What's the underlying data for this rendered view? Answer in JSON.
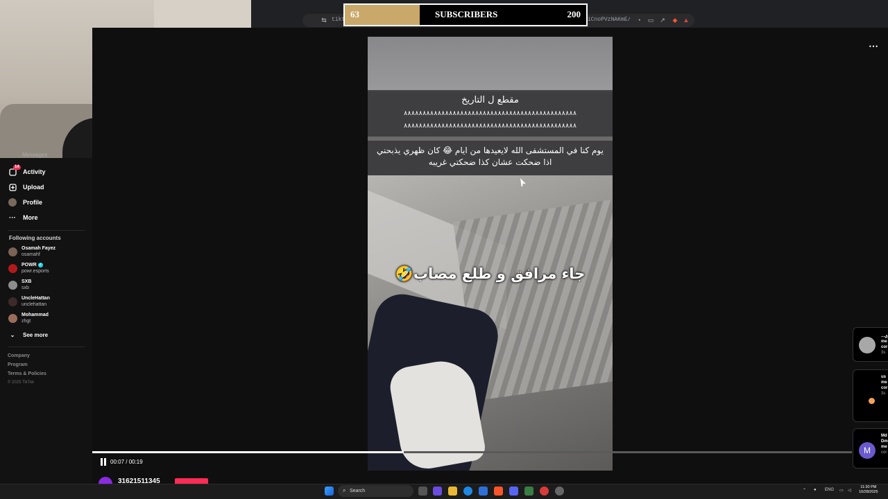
{
  "browser": {
    "url": "tiktok.com/@.../video/... MfDjnyZmkv8IzH-Kd7Y83j5-U8RbfWbvEZ8iAii1qfUiCnoPVzNAKmE/video/7549859768807066898",
    "url_prefix": "tiktok"
  },
  "subscribers": {
    "start": "63",
    "label": "SUBSCRIBERS",
    "goal": "200",
    "progress_fraction": 0.31
  },
  "sidebar": {
    "cut_item": "Messages",
    "items": [
      {
        "label": "Activity",
        "icon": "activity-icon",
        "badge": "14"
      },
      {
        "label": "Upload",
        "icon": "upload-icon"
      },
      {
        "label": "Profile",
        "icon": "profile-avatar"
      },
      {
        "label": "More",
        "icon": "more-dots-icon"
      }
    ],
    "following_title": "Following accounts",
    "accounts": [
      {
        "name": "Osamah Fayez",
        "handle": "osamahf"
      },
      {
        "name": "POWR",
        "handle": "powr.esports",
        "verified": true
      },
      {
        "name": "SXB",
        "handle": "sxb"
      },
      {
        "name": "UncleHattan",
        "handle": "unclehattan"
      },
      {
        "name": "Mohammad",
        "handle": "zhgt"
      }
    ],
    "see_more": "See more",
    "footer": [
      "Company",
      "Program",
      "Terms & Policies"
    ],
    "copyright": "© 2025 TikTok"
  },
  "video": {
    "caption_title": "مقطع ل التاريخ",
    "caption_line1": "٨٨٨٨٨٨٨٨٨٨٨٨٨٨٨٨٨٨٨٨٨٨٨٨٨٨٨٨٨٨٨٨٨٨٨٨٨٨٨٨٨٨٨٨٨٨",
    "caption_line2": "٨٨٨٨٨٨٨٨٨٨٨٨٨٨٨٨٨٨٨٨٨٨٨٨٨٨٨٨٨٨٨٨٨٨٨٨٨٨٨٨٨٨٨٨٨٨",
    "caption_text": "يوم كنا في المستشفى الله لايعيدها من ايام 😂 كان ظهري يذبحني اذا ضحكت عشان كذا ضحكتي غريبه",
    "caption_big": "جاء مرافق و طلع مصاب🤣",
    "time": "00:07 / 00:19",
    "progress_fraction": 0.41,
    "author": "31621511345"
  },
  "notifications": [
    {
      "l1": "...تري",
      "l2": "me",
      "l3": "cor",
      "time": "3s"
    },
    {
      "l1": "us",
      "l2": "me",
      "l3": "cor",
      "time": "3s"
    },
    {
      "l1": "Md",
      "l2": "Dm",
      "l3": "me",
      "time": "cor"
    }
  ],
  "taskbar": {
    "search": "Search",
    "lang": "ENG",
    "time": "11:30 PM",
    "date": "10/28/2025"
  },
  "colors": {
    "accent": "#fe2c55",
    "subs_fill": "#c9a86a",
    "verified": "#20d5ec"
  }
}
